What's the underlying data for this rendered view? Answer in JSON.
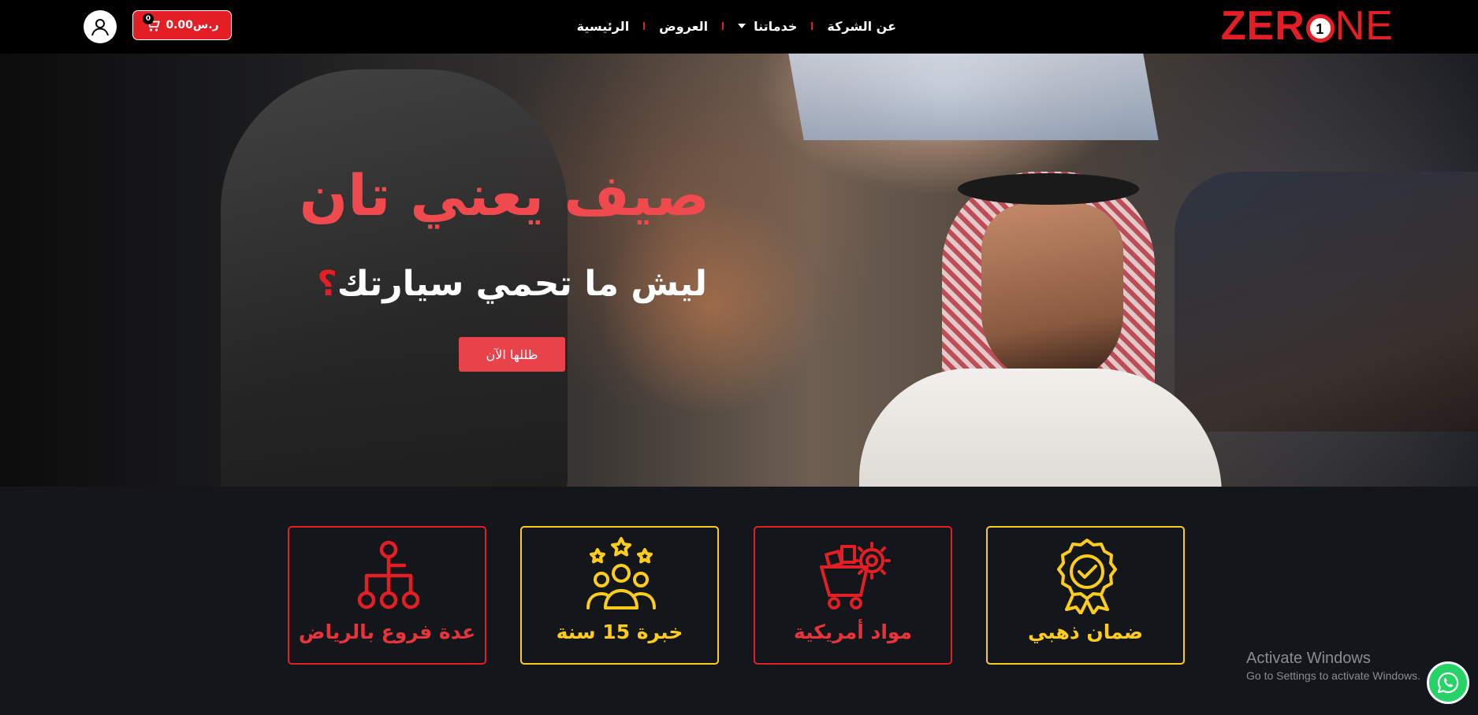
{
  "header": {
    "logo_text_left": "ZER",
    "logo_digit": "1",
    "logo_text_right": "NE",
    "nav": [
      {
        "label": "الرئيسية"
      },
      {
        "label": "العروض"
      },
      {
        "label": "خدماتنا"
      },
      {
        "label": "عن الشركة"
      }
    ],
    "cart": {
      "total": "ر.س0.00",
      "count": "0",
      "icon": "cart-icon"
    },
    "user_icon": "user-icon"
  },
  "hero": {
    "title": "صيف يعني تان",
    "subtitle_main": "ليش ما تحمي سيارتك",
    "subtitle_mark": "؟",
    "cta_label": "ظللها الآن"
  },
  "features": [
    {
      "label": "ضمان ذهبي",
      "icon": "gold-badge-icon",
      "color": "#ffcc1a"
    },
    {
      "label": "مواد أمريكية",
      "icon": "materials-cart-icon",
      "color": "#e31e24"
    },
    {
      "label": "خبرة 15 سنة",
      "icon": "team-stars-icon",
      "color": "#ffcc1a"
    },
    {
      "label": "عدة فروع بالرياض",
      "icon": "branches-icon",
      "color": "#e31e24"
    }
  ],
  "watermark": {
    "line1": "Activate Windows",
    "line2": "Go to Settings to activate Windows."
  },
  "whatsapp_icon": "whatsapp-icon",
  "colors": {
    "brand_red": "#e31e24",
    "accent_yellow": "#ffcc1a",
    "page_bg": "#13171c"
  }
}
